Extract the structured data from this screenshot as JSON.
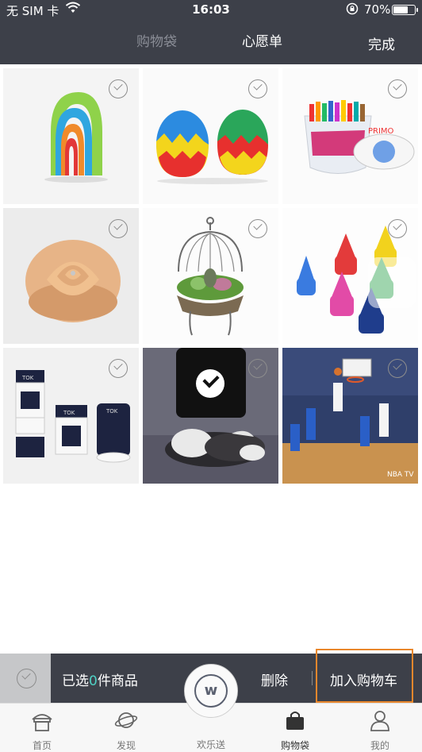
{
  "status_bar": {
    "carrier": "无 SIM 卡",
    "time": "16:03",
    "battery": "70%",
    "battery_level": 0.7
  },
  "header": {
    "tab_cart": "购物袋",
    "tab_wishlist": "心愿单",
    "done": "完成"
  },
  "products": [
    {
      "name": "rainbow-stacker",
      "selected": false
    },
    {
      "name": "egg-toys",
      "selected": false
    },
    {
      "name": "crayon-bucket",
      "selected": false
    },
    {
      "name": "wooden-rose",
      "selected": false
    },
    {
      "name": "birdcage-planter",
      "selected": false
    },
    {
      "name": "cone-crayons",
      "selected": false
    },
    {
      "name": "tok-containers",
      "selected": false
    },
    {
      "name": "husky-photo",
      "selected": true
    },
    {
      "name": "basketball-photo",
      "selected": false
    }
  ],
  "actionbar": {
    "summary_prefix": "已选",
    "count": "0",
    "summary_suffix": "件商品",
    "delete": "删除",
    "add_to_cart": "加入购物车"
  },
  "tabbar": {
    "home": "首页",
    "discover": "发现",
    "center": "欢乐送",
    "bag": "购物袋",
    "mine": "我的"
  },
  "colors": {
    "header_bg": "#3d4049",
    "accent_count": "#4fd1c5",
    "highlight_border": "#e9872c"
  }
}
